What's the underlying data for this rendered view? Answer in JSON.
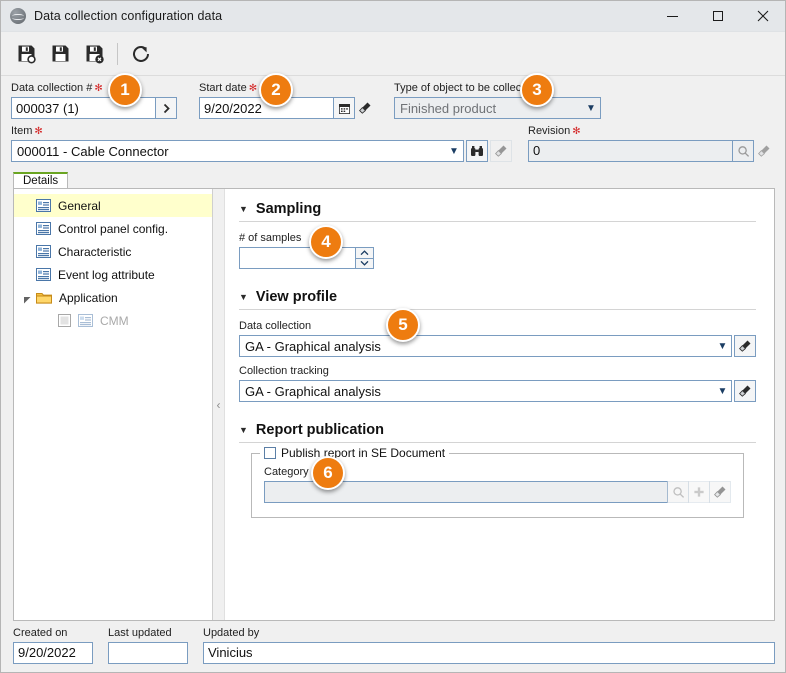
{
  "window": {
    "title": "Data collection configuration data",
    "app_icon": "globe-icon",
    "controls": {
      "minimize": "minimize-icon",
      "maximize": "maximize-icon",
      "close": "close-icon"
    }
  },
  "toolbar": {
    "buttons": [
      {
        "name": "save-and-new-button",
        "icon": "floppy-plus-icon",
        "title": "Save and create new"
      },
      {
        "name": "save-button",
        "icon": "floppy-icon",
        "title": "Save"
      },
      {
        "name": "save-and-exit-button",
        "icon": "floppy-close-icon",
        "title": "Save and exit"
      },
      {
        "name": "refresh-button",
        "icon": "refresh-icon",
        "title": "Refresh"
      }
    ]
  },
  "header_fields": {
    "data_collection": {
      "label": "Data collection #",
      "required": true,
      "value": "000037 (1)",
      "button_icon": "chevron-right-icon"
    },
    "start_date": {
      "label": "Start date",
      "required": true,
      "value": "9/20/2022",
      "calendar_icon": "calendar-icon",
      "clear_icon": "brush-icon"
    },
    "type_of_object": {
      "label": "Type of object to be collected",
      "required": true,
      "value": "Finished product",
      "readonly": true,
      "caret_icon": "chevron-down-icon"
    },
    "item": {
      "label": "Item",
      "required": true,
      "value": "000011 - Cable Connector",
      "caret_icon": "chevron-down-icon",
      "search_icon": "binoculars-icon",
      "clear_icon": "brush-icon"
    },
    "revision": {
      "label": "Revision",
      "required": true,
      "value": "0",
      "readonly": true,
      "search_icon": "magnifier-icon",
      "clear_icon": "brush-icon"
    }
  },
  "tabs": [
    {
      "label": "Details",
      "active": true
    }
  ],
  "tree": {
    "items": [
      {
        "label": "General",
        "icon": "form-icon",
        "selected": true,
        "level": 0
      },
      {
        "label": "Control panel config.",
        "icon": "form-icon",
        "selected": false,
        "level": 0
      },
      {
        "label": "Characteristic",
        "icon": "form-icon",
        "selected": false,
        "level": 0
      },
      {
        "label": "Event log attribute",
        "icon": "form-icon",
        "selected": false,
        "level": 0
      },
      {
        "label": "Application",
        "icon": "folder-icon",
        "selected": false,
        "level": 0,
        "expanded": true
      },
      {
        "label": "CMM",
        "icon": "form-icon",
        "selected": false,
        "level": 1,
        "disabled": true,
        "checkbox": true
      }
    ]
  },
  "splitter": {
    "collapse_icon": "chevron-left-icon"
  },
  "sections": {
    "sampling": {
      "title": "Sampling",
      "collapse_icon": "triangle-down-icon",
      "num_samples": {
        "label": "# of samples",
        "value": "",
        "spinner_up": "chevron-up-icon",
        "spinner_down": "chevron-down-icon"
      }
    },
    "view_profile": {
      "title": "View profile",
      "collapse_icon": "triangle-down-icon",
      "data_collection": {
        "label": "Data collection",
        "value": "GA - Graphical analysis",
        "caret_icon": "chevron-down-icon",
        "clear_icon": "brush-icon"
      },
      "collection_tracking": {
        "label": "Collection tracking",
        "value": "GA - Graphical analysis",
        "caret_icon": "chevron-down-icon",
        "clear_icon": "brush-icon"
      }
    },
    "report_publication": {
      "title": "Report publication",
      "collapse_icon": "triangle-down-icon",
      "publish_checkbox": {
        "label": "Publish report in SE Document",
        "checked": false
      },
      "category": {
        "label": "Category",
        "value": "",
        "readonly": true,
        "search_icon": "magnifier-icon",
        "add_icon": "plus-icon",
        "clear_icon": "brush-icon"
      }
    }
  },
  "footer": {
    "created_on": {
      "label": "Created on",
      "value": "9/20/2022"
    },
    "last_updated": {
      "label": "Last updated",
      "value": ""
    },
    "updated_by": {
      "label": "Updated by",
      "value": "Vinicius"
    }
  },
  "callouts": [
    {
      "id": "1",
      "number": "1"
    },
    {
      "id": "2",
      "number": "2"
    },
    {
      "id": "3",
      "number": "3"
    },
    {
      "id": "4",
      "number": "4"
    },
    {
      "id": "5",
      "number": "5"
    },
    {
      "id": "6",
      "number": "6"
    }
  ],
  "colors": {
    "accent_orange": "#ee7c10",
    "required_red": "#d42a2a",
    "tab_green": "#6aa521",
    "selection_yellow": "#ffffcc",
    "field_border": "#7a9cc0"
  }
}
